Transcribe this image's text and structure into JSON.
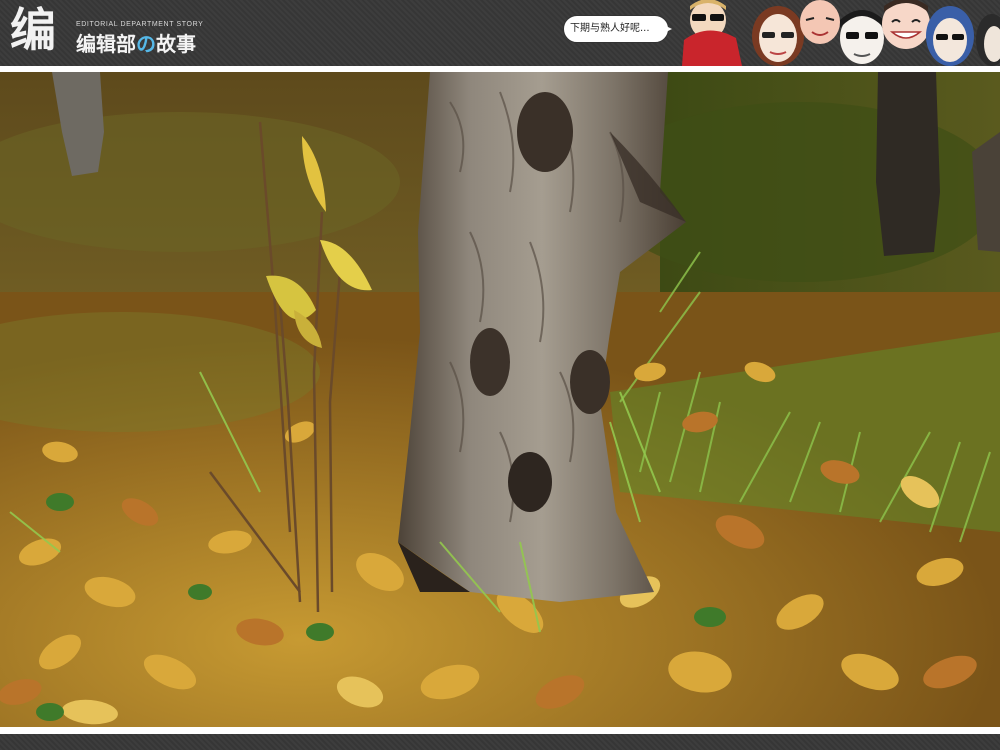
{
  "header": {
    "logo_mark": "编",
    "logo_subtitle": "EDITORIAL DEPARTMENT STORY",
    "logo_name_pre": "编辑部",
    "logo_name_accent": "の",
    "logo_name_post": "故事",
    "speech_bubble": "下期与熟人好呢..."
  },
  "icons": [
    "character-faces-illustration"
  ],
  "colors": {
    "header_bg": "#3b3b3b",
    "accent": "#55b8e8",
    "separator": "#ffffff"
  }
}
